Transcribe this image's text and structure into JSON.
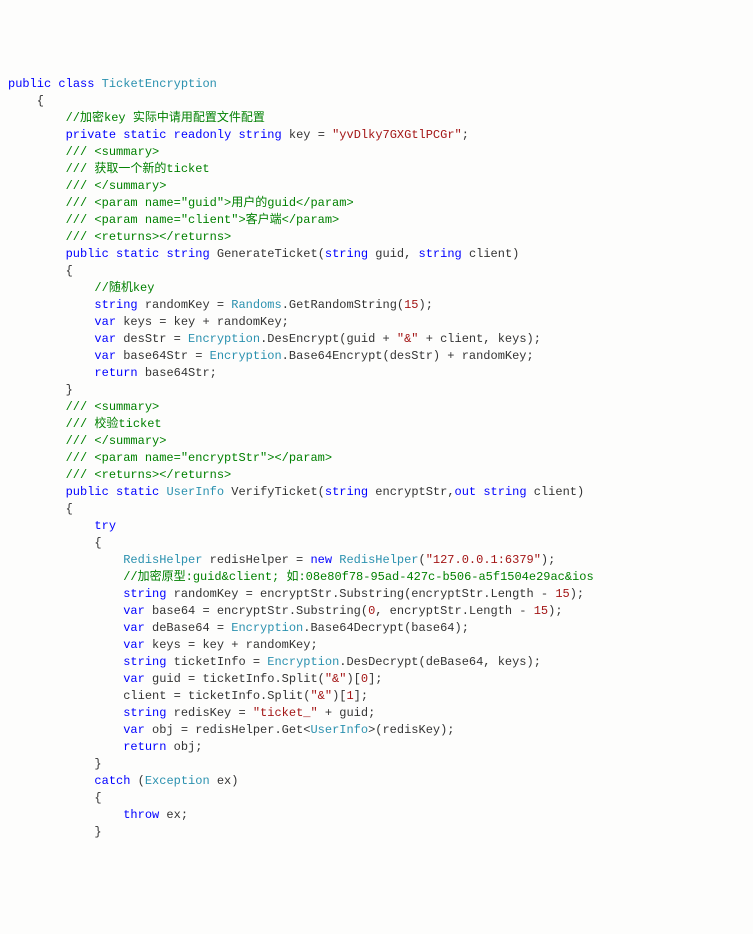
{
  "lines": [
    [
      {
        "c": "kw",
        "t": "public"
      },
      {
        "c": "id",
        "t": " "
      },
      {
        "c": "kw",
        "t": "class"
      },
      {
        "c": "id",
        "t": " "
      },
      {
        "c": "type",
        "t": "TicketEncryption"
      }
    ],
    [
      {
        "c": "id",
        "t": "    {"
      }
    ],
    [
      {
        "c": "id",
        "t": "        "
      },
      {
        "c": "cmt",
        "t": "//加密key 实际中请用配置文件配置"
      }
    ],
    [
      {
        "c": "id",
        "t": "        "
      },
      {
        "c": "kw",
        "t": "private"
      },
      {
        "c": "id",
        "t": " "
      },
      {
        "c": "kw",
        "t": "static"
      },
      {
        "c": "id",
        "t": " "
      },
      {
        "c": "kw",
        "t": "readonly"
      },
      {
        "c": "id",
        "t": " "
      },
      {
        "c": "kw",
        "t": "string"
      },
      {
        "c": "id",
        "t": " key = "
      },
      {
        "c": "str",
        "t": "\"yvDlky7GXGtlPCGr\""
      },
      {
        "c": "id",
        "t": ";"
      }
    ],
    [
      {
        "c": "id",
        "t": "        "
      },
      {
        "c": "cmt",
        "t": "/// <summary>"
      }
    ],
    [
      {
        "c": "id",
        "t": "        "
      },
      {
        "c": "cmt",
        "t": "/// 获取一个新的ticket"
      }
    ],
    [
      {
        "c": "id",
        "t": "        "
      },
      {
        "c": "cmt",
        "t": "/// </summary>"
      }
    ],
    [
      {
        "c": "id",
        "t": "        "
      },
      {
        "c": "cmt",
        "t": "/// <param name=\"guid\">用户的guid</param>"
      }
    ],
    [
      {
        "c": "id",
        "t": "        "
      },
      {
        "c": "cmt",
        "t": "/// <param name=\"client\">客户端</param>"
      }
    ],
    [
      {
        "c": "id",
        "t": "        "
      },
      {
        "c": "cmt",
        "t": "/// <returns></returns>"
      }
    ],
    [
      {
        "c": "id",
        "t": "        "
      },
      {
        "c": "kw",
        "t": "public"
      },
      {
        "c": "id",
        "t": " "
      },
      {
        "c": "kw",
        "t": "static"
      },
      {
        "c": "id",
        "t": " "
      },
      {
        "c": "kw",
        "t": "string"
      },
      {
        "c": "id",
        "t": " GenerateTicket("
      },
      {
        "c": "kw",
        "t": "string"
      },
      {
        "c": "id",
        "t": " guid, "
      },
      {
        "c": "kw",
        "t": "string"
      },
      {
        "c": "id",
        "t": " client)"
      }
    ],
    [
      {
        "c": "id",
        "t": "        {"
      }
    ],
    [
      {
        "c": "id",
        "t": "            "
      },
      {
        "c": "cmt",
        "t": "//随机key"
      }
    ],
    [
      {
        "c": "id",
        "t": "            "
      },
      {
        "c": "kw",
        "t": "string"
      },
      {
        "c": "id",
        "t": " randomKey = "
      },
      {
        "c": "type",
        "t": "Randoms"
      },
      {
        "c": "id",
        "t": ".GetRandomString("
      },
      {
        "c": "str",
        "t": "15"
      },
      {
        "c": "id",
        "t": ");"
      }
    ],
    [
      {
        "c": "id",
        "t": "            "
      },
      {
        "c": "kw",
        "t": "var"
      },
      {
        "c": "id",
        "t": " keys = key + randomKey;"
      }
    ],
    [
      {
        "c": "id",
        "t": "            "
      },
      {
        "c": "kw",
        "t": "var"
      },
      {
        "c": "id",
        "t": " desStr = "
      },
      {
        "c": "type",
        "t": "Encryption"
      },
      {
        "c": "id",
        "t": ".DesEncrypt(guid + "
      },
      {
        "c": "str",
        "t": "\"&\""
      },
      {
        "c": "id",
        "t": " + client, keys);"
      }
    ],
    [
      {
        "c": "id",
        "t": "            "
      },
      {
        "c": "kw",
        "t": "var"
      },
      {
        "c": "id",
        "t": " base64Str = "
      },
      {
        "c": "type",
        "t": "Encryption"
      },
      {
        "c": "id",
        "t": ".Base64Encrypt(desStr) + randomKey;"
      }
    ],
    [
      {
        "c": "id",
        "t": "            "
      },
      {
        "c": "kw",
        "t": "return"
      },
      {
        "c": "id",
        "t": " base64Str;"
      }
    ],
    [
      {
        "c": "id",
        "t": "        }"
      }
    ],
    [
      {
        "c": "id",
        "t": ""
      }
    ],
    [
      {
        "c": "id",
        "t": "        "
      },
      {
        "c": "cmt",
        "t": "/// <summary>"
      }
    ],
    [
      {
        "c": "id",
        "t": "        "
      },
      {
        "c": "cmt",
        "t": "/// 校验ticket"
      }
    ],
    [
      {
        "c": "id",
        "t": "        "
      },
      {
        "c": "cmt",
        "t": "/// </summary>"
      }
    ],
    [
      {
        "c": "id",
        "t": "        "
      },
      {
        "c": "cmt",
        "t": "/// <param name=\"encryptStr\"></param>"
      }
    ],
    [
      {
        "c": "id",
        "t": "        "
      },
      {
        "c": "cmt",
        "t": "/// <returns></returns>"
      }
    ],
    [
      {
        "c": "id",
        "t": "        "
      },
      {
        "c": "kw",
        "t": "public"
      },
      {
        "c": "id",
        "t": " "
      },
      {
        "c": "kw",
        "t": "static"
      },
      {
        "c": "id",
        "t": " "
      },
      {
        "c": "type",
        "t": "UserInfo"
      },
      {
        "c": "id",
        "t": " VerifyTicket("
      },
      {
        "c": "kw",
        "t": "string"
      },
      {
        "c": "id",
        "t": " encryptStr,"
      },
      {
        "c": "kw",
        "t": "out"
      },
      {
        "c": "id",
        "t": " "
      },
      {
        "c": "kw",
        "t": "string"
      },
      {
        "c": "id",
        "t": " client)"
      }
    ],
    [
      {
        "c": "id",
        "t": "        {"
      }
    ],
    [
      {
        "c": "id",
        "t": "            "
      },
      {
        "c": "kw",
        "t": "try"
      }
    ],
    [
      {
        "c": "id",
        "t": "            {"
      }
    ],
    [
      {
        "c": "id",
        "t": "                "
      },
      {
        "c": "type",
        "t": "RedisHelper"
      },
      {
        "c": "id",
        "t": " redisHelper = "
      },
      {
        "c": "kw",
        "t": "new"
      },
      {
        "c": "id",
        "t": " "
      },
      {
        "c": "type",
        "t": "RedisHelper"
      },
      {
        "c": "id",
        "t": "("
      },
      {
        "c": "str",
        "t": "\"127.0.0.1:6379\""
      },
      {
        "c": "id",
        "t": ");"
      }
    ],
    [
      {
        "c": "id",
        "t": "                "
      },
      {
        "c": "cmt",
        "t": "//加密原型:guid&client; 如:08e80f78-95ad-427c-b506-a5f1504e29ac&ios"
      }
    ],
    [
      {
        "c": "id",
        "t": "                "
      },
      {
        "c": "kw",
        "t": "string"
      },
      {
        "c": "id",
        "t": " randomKey = encryptStr.Substring(encryptStr.Length - "
      },
      {
        "c": "str",
        "t": "15"
      },
      {
        "c": "id",
        "t": ");"
      }
    ],
    [
      {
        "c": "id",
        "t": "                "
      },
      {
        "c": "kw",
        "t": "var"
      },
      {
        "c": "id",
        "t": " base64 = encryptStr.Substring("
      },
      {
        "c": "str",
        "t": "0"
      },
      {
        "c": "id",
        "t": ", encryptStr.Length - "
      },
      {
        "c": "str",
        "t": "15"
      },
      {
        "c": "id",
        "t": ");"
      }
    ],
    [
      {
        "c": "id",
        "t": "                "
      },
      {
        "c": "kw",
        "t": "var"
      },
      {
        "c": "id",
        "t": " deBase64 = "
      },
      {
        "c": "type",
        "t": "Encryption"
      },
      {
        "c": "id",
        "t": ".Base64Decrypt(base64);"
      }
    ],
    [
      {
        "c": "id",
        "t": "                "
      },
      {
        "c": "kw",
        "t": "var"
      },
      {
        "c": "id",
        "t": " keys = key + randomKey;"
      }
    ],
    [
      {
        "c": "id",
        "t": "                "
      },
      {
        "c": "kw",
        "t": "string"
      },
      {
        "c": "id",
        "t": " ticketInfo = "
      },
      {
        "c": "type",
        "t": "Encryption"
      },
      {
        "c": "id",
        "t": ".DesDecrypt(deBase64, keys);"
      }
    ],
    [
      {
        "c": "id",
        "t": "                "
      },
      {
        "c": "kw",
        "t": "var"
      },
      {
        "c": "id",
        "t": " guid = ticketInfo.Split("
      },
      {
        "c": "str",
        "t": "\"&\""
      },
      {
        "c": "id",
        "t": ")["
      },
      {
        "c": "str",
        "t": "0"
      },
      {
        "c": "id",
        "t": "];"
      }
    ],
    [
      {
        "c": "id",
        "t": "                client = ticketInfo.Split("
      },
      {
        "c": "str",
        "t": "\"&\""
      },
      {
        "c": "id",
        "t": ")["
      },
      {
        "c": "str",
        "t": "1"
      },
      {
        "c": "id",
        "t": "];"
      }
    ],
    [
      {
        "c": "id",
        "t": "                "
      },
      {
        "c": "kw",
        "t": "string"
      },
      {
        "c": "id",
        "t": " redisKey = "
      },
      {
        "c": "str",
        "t": "\"ticket_\""
      },
      {
        "c": "id",
        "t": " + guid;"
      }
    ],
    [
      {
        "c": "id",
        "t": "                "
      },
      {
        "c": "kw",
        "t": "var"
      },
      {
        "c": "id",
        "t": " obj = redisHelper.Get<"
      },
      {
        "c": "type",
        "t": "UserInfo"
      },
      {
        "c": "id",
        "t": ">(redisKey);"
      }
    ],
    [
      {
        "c": "id",
        "t": "                "
      },
      {
        "c": "kw",
        "t": "return"
      },
      {
        "c": "id",
        "t": " obj;"
      }
    ],
    [
      {
        "c": "id",
        "t": "            }"
      }
    ],
    [
      {
        "c": "id",
        "t": "            "
      },
      {
        "c": "kw",
        "t": "catch"
      },
      {
        "c": "id",
        "t": " ("
      },
      {
        "c": "type",
        "t": "Exception"
      },
      {
        "c": "id",
        "t": " ex)"
      }
    ],
    [
      {
        "c": "id",
        "t": "            {"
      }
    ],
    [
      {
        "c": "id",
        "t": "                "
      },
      {
        "c": "kw",
        "t": "throw"
      },
      {
        "c": "id",
        "t": " ex;"
      }
    ],
    [
      {
        "c": "id",
        "t": "            }"
      }
    ]
  ]
}
